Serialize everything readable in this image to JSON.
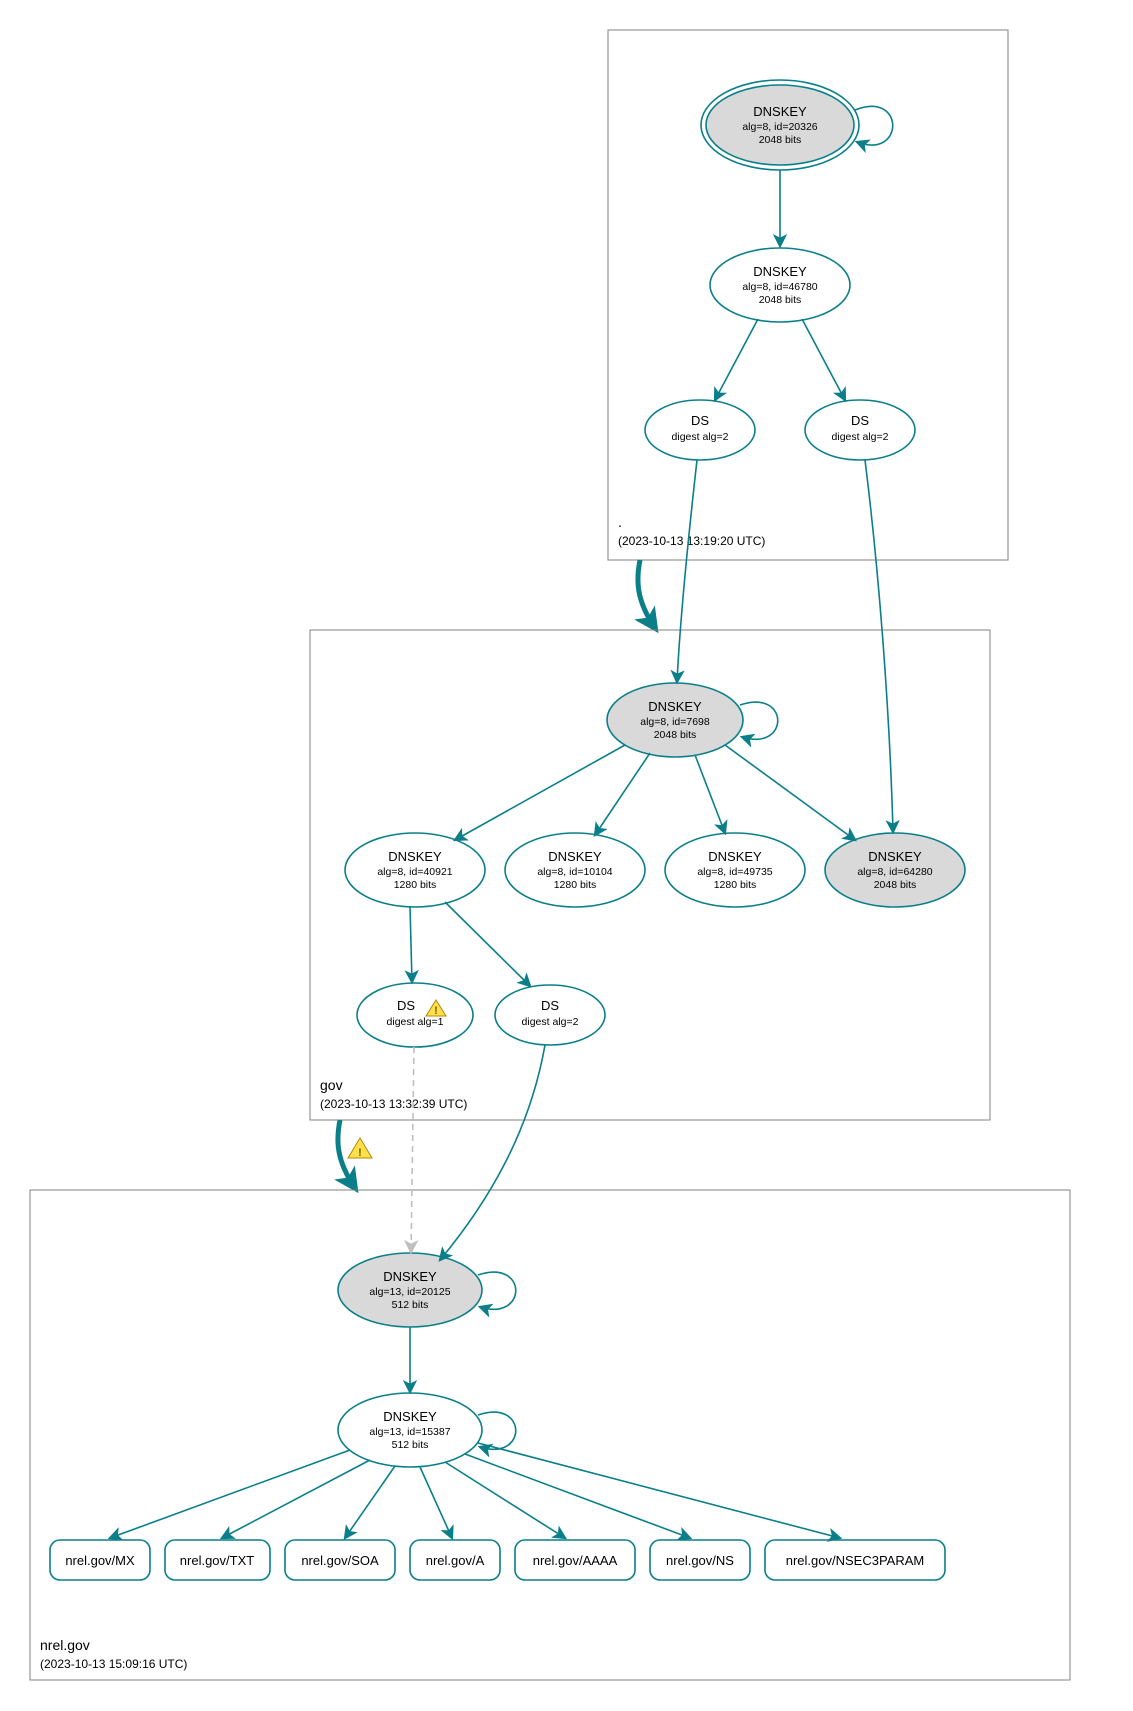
{
  "chart_data": {
    "type": "graph",
    "zones": [
      {
        "id": "root",
        "label": ".",
        "timestamp": "(2023-10-13 13:19:20 UTC)"
      },
      {
        "id": "gov",
        "label": "gov",
        "timestamp": "(2023-10-13 13:32:39 UTC)"
      },
      {
        "id": "nrel",
        "label": "nrel.gov",
        "timestamp": "(2023-10-13 15:09:16 UTC)"
      }
    ],
    "nodes": [
      {
        "id": "root_ksk",
        "zone": "root",
        "title": "DNSKEY",
        "line2": "alg=8, id=20326",
        "line3": "2048 bits",
        "grey": true,
        "double": true
      },
      {
        "id": "root_zsk",
        "zone": "root",
        "title": "DNSKEY",
        "line2": "alg=8, id=46780",
        "line3": "2048 bits",
        "grey": false,
        "double": false
      },
      {
        "id": "root_ds1",
        "zone": "root",
        "title": "DS",
        "line2": "digest alg=2",
        "line3": "",
        "grey": false,
        "double": false
      },
      {
        "id": "root_ds2",
        "zone": "root",
        "title": "DS",
        "line2": "digest alg=2",
        "line3": "",
        "grey": false,
        "double": false
      },
      {
        "id": "gov_ksk",
        "zone": "gov",
        "title": "DNSKEY",
        "line2": "alg=8, id=7698",
        "line3": "2048 bits",
        "grey": true,
        "double": false
      },
      {
        "id": "gov_zsk1",
        "zone": "gov",
        "title": "DNSKEY",
        "line2": "alg=8, id=40921",
        "line3": "1280 bits",
        "grey": false,
        "double": false
      },
      {
        "id": "gov_zsk2",
        "zone": "gov",
        "title": "DNSKEY",
        "line2": "alg=8, id=10104",
        "line3": "1280 bits",
        "grey": false,
        "double": false
      },
      {
        "id": "gov_zsk3",
        "zone": "gov",
        "title": "DNSKEY",
        "line2": "alg=8, id=49735",
        "line3": "1280 bits",
        "grey": false,
        "double": false
      },
      {
        "id": "gov_zsk4",
        "zone": "gov",
        "title": "DNSKEY",
        "line2": "alg=8, id=64280",
        "line3": "2048 bits",
        "grey": true,
        "double": false
      },
      {
        "id": "gov_ds1",
        "zone": "gov",
        "title": "DS",
        "line2": "digest alg=1",
        "line3": "",
        "grey": false,
        "double": false,
        "warn": true
      },
      {
        "id": "gov_ds2",
        "zone": "gov",
        "title": "DS",
        "line2": "digest alg=2",
        "line3": "",
        "grey": false,
        "double": false
      },
      {
        "id": "nrel_ksk",
        "zone": "nrel",
        "title": "DNSKEY",
        "line2": "alg=13, id=20125",
        "line3": "512 bits",
        "grey": true,
        "double": false
      },
      {
        "id": "nrel_zsk",
        "zone": "nrel",
        "title": "DNSKEY",
        "line2": "alg=13, id=15387",
        "line3": "512 bits",
        "grey": false,
        "double": false
      }
    ],
    "rrsets": [
      {
        "id": "rr_mx",
        "label": "nrel.gov/MX"
      },
      {
        "id": "rr_txt",
        "label": "nrel.gov/TXT"
      },
      {
        "id": "rr_soa",
        "label": "nrel.gov/SOA"
      },
      {
        "id": "rr_a",
        "label": "nrel.gov/A"
      },
      {
        "id": "rr_aaaa",
        "label": "nrel.gov/AAAA"
      },
      {
        "id": "rr_ns",
        "label": "nrel.gov/NS"
      },
      {
        "id": "rr_nsec3",
        "label": "nrel.gov/NSEC3PARAM"
      }
    ],
    "edges": [
      {
        "from": "root_ksk",
        "to": "root_ksk",
        "self": true
      },
      {
        "from": "root_ksk",
        "to": "root_zsk"
      },
      {
        "from": "root_zsk",
        "to": "root_ds1"
      },
      {
        "from": "root_zsk",
        "to": "root_ds2"
      },
      {
        "from": "root_ds1",
        "to": "gov_ksk"
      },
      {
        "from": "root_ds2",
        "to": "gov_zsk4"
      },
      {
        "from": "gov_ksk",
        "to": "gov_ksk",
        "self": true
      },
      {
        "from": "gov_ksk",
        "to": "gov_zsk1"
      },
      {
        "from": "gov_ksk",
        "to": "gov_zsk2"
      },
      {
        "from": "gov_ksk",
        "to": "gov_zsk3"
      },
      {
        "from": "gov_ksk",
        "to": "gov_zsk4"
      },
      {
        "from": "gov_zsk1",
        "to": "gov_ds1"
      },
      {
        "from": "gov_zsk1",
        "to": "gov_ds2"
      },
      {
        "from": "gov_ds1",
        "to": "nrel_ksk",
        "dashed": true
      },
      {
        "from": "gov_ds2",
        "to": "nrel_ksk"
      },
      {
        "from": "nrel_ksk",
        "to": "nrel_ksk",
        "self": true
      },
      {
        "from": "nrel_ksk",
        "to": "nrel_zsk"
      },
      {
        "from": "nrel_zsk",
        "to": "nrel_zsk",
        "self": true
      },
      {
        "from": "nrel_zsk",
        "to": "rr_mx"
      },
      {
        "from": "nrel_zsk",
        "to": "rr_txt"
      },
      {
        "from": "nrel_zsk",
        "to": "rr_soa"
      },
      {
        "from": "nrel_zsk",
        "to": "rr_a"
      },
      {
        "from": "nrel_zsk",
        "to": "rr_aaaa"
      },
      {
        "from": "nrel_zsk",
        "to": "rr_ns"
      },
      {
        "from": "nrel_zsk",
        "to": "rr_nsec3"
      }
    ],
    "delegation_edges": [
      {
        "from_zone": "root",
        "to_zone": "gov",
        "warn": false
      },
      {
        "from_zone": "gov",
        "to_zone": "nrel",
        "warn": true
      }
    ]
  },
  "colors": {
    "stroke": "#0a7f8a",
    "grey_fill": "#d9d9d9",
    "box_stroke": "#808080"
  }
}
